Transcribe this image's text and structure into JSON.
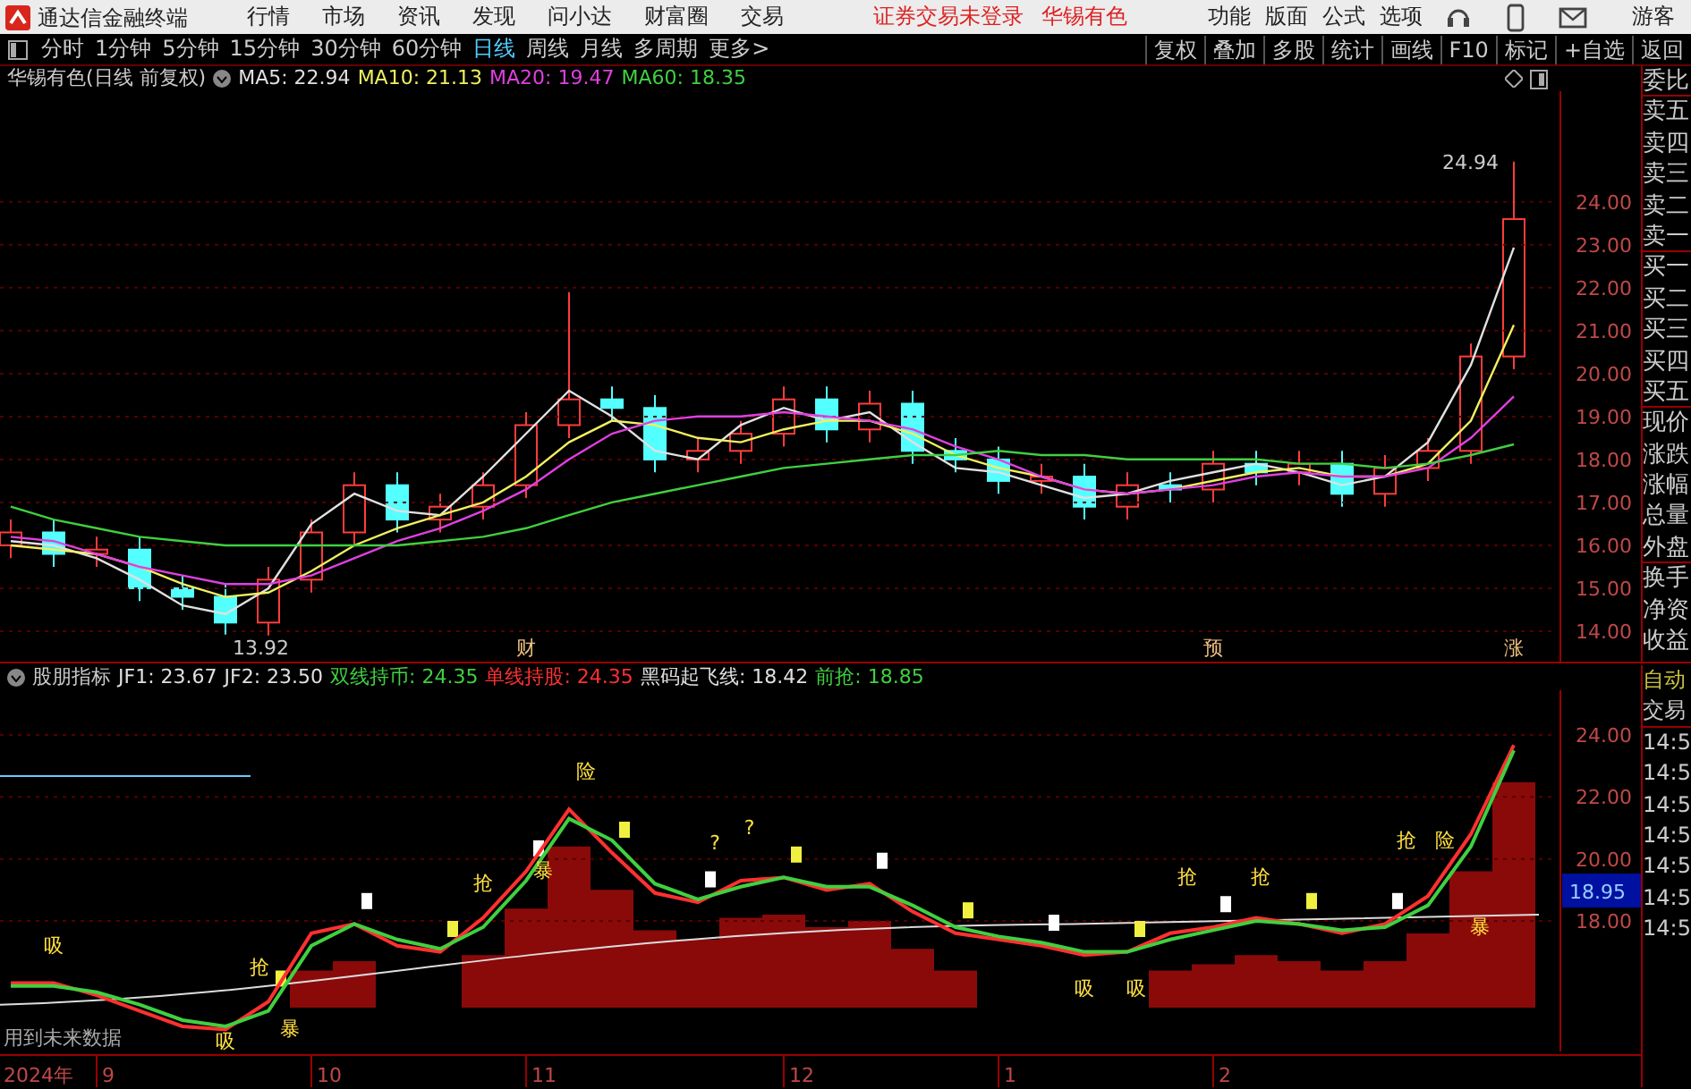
{
  "title_bar": {
    "app_title": "通达信金融终端",
    "menu": [
      "行情",
      "市场",
      "资讯",
      "发现",
      "问小达",
      "财富圈",
      "交易"
    ],
    "notices": [
      "证券交易未登录",
      "华锡有色"
    ],
    "right_menu": [
      "功能",
      "版面",
      "公式",
      "选项"
    ],
    "user": "游客"
  },
  "period_tabs": [
    {
      "label": "分时",
      "selected": false
    },
    {
      "label": "1分钟",
      "selected": false
    },
    {
      "label": "5分钟",
      "selected": false
    },
    {
      "label": "15分钟",
      "selected": false
    },
    {
      "label": "30分钟",
      "selected": false
    },
    {
      "label": "60分钟",
      "selected": false
    },
    {
      "label": "日线",
      "selected": true
    },
    {
      "label": "周线",
      "selected": false
    },
    {
      "label": "月线",
      "selected": false
    },
    {
      "label": "多周期",
      "selected": false
    },
    {
      "label": "更多>",
      "selected": false
    }
  ],
  "tool_buttons": [
    "复权",
    "叠加",
    "多股",
    "统计",
    "画线",
    "F10",
    "标记",
    "+自选",
    "返回"
  ],
  "price_chart": {
    "title": "华锡有色(日线 前复权)",
    "legend": [
      {
        "label": "MA5: 22.94",
        "color": "#e0e0e0"
      },
      {
        "label": "MA10: 21.13",
        "color": "#f0f060"
      },
      {
        "label": "MA20: 19.47",
        "color": "#e040e0"
      },
      {
        "label": "MA60: 18.35",
        "color": "#40d040"
      }
    ],
    "low_label": "13.92",
    "high_label": "24.94",
    "event_flags": [
      "财",
      "预",
      "涨"
    ],
    "candles": {
      "chart_data": {
        "type": "candlestick",
        "grid": true,
        "categories": [
          null,
          null,
          null,
          null,
          null,
          null,
          null,
          null,
          null,
          null,
          null,
          null,
          null,
          null,
          null,
          null,
          null,
          null,
          null,
          null,
          null,
          null,
          null,
          null,
          null,
          null,
          null,
          null,
          null,
          null,
          null,
          null,
          null,
          null,
          null,
          null
        ],
        "ylim": [
          13.29,
          26.58
        ],
        "yticks": [
          {
            "value": 14,
            "label": "14.00"
          },
          {
            "value": 16,
            "label": "16.00"
          },
          {
            "value": 18,
            "label": "18.00"
          },
          {
            "value": 20,
            "label": "20.00"
          },
          {
            "value": 22,
            "label": "22.00"
          },
          {
            "value": 24,
            "label": "24.00"
          }
        ],
        "ohlc": [
          [
            16.0,
            16.6,
            15.7,
            16.3
          ],
          [
            16.3,
            16.6,
            15.5,
            15.8
          ],
          [
            15.8,
            16.2,
            15.5,
            15.9
          ],
          [
            15.9,
            16.2,
            14.7,
            15.0
          ],
          [
            15.0,
            15.3,
            14.5,
            14.8
          ],
          [
            14.8,
            15.1,
            13.92,
            14.2
          ],
          [
            14.2,
            15.5,
            13.9,
            15.2
          ],
          [
            15.2,
            16.6,
            14.9,
            16.3
          ],
          [
            16.3,
            17.7,
            16.0,
            17.4
          ],
          [
            17.4,
            17.7,
            16.3,
            16.6
          ],
          [
            16.6,
            17.2,
            16.3,
            16.9
          ],
          [
            16.9,
            17.7,
            16.6,
            17.4
          ],
          [
            17.4,
            19.1,
            17.1,
            18.8
          ],
          [
            18.8,
            21.9,
            18.5,
            19.4
          ],
          [
            19.4,
            19.7,
            18.9,
            19.2
          ],
          [
            19.2,
            19.5,
            17.7,
            18.0
          ],
          [
            18.0,
            18.5,
            17.7,
            18.2
          ],
          [
            18.2,
            18.9,
            17.9,
            18.6
          ],
          [
            18.6,
            19.7,
            18.3,
            19.4
          ],
          [
            19.4,
            19.7,
            18.4,
            18.7
          ],
          [
            18.7,
            19.6,
            18.4,
            19.3
          ],
          [
            19.3,
            19.6,
            17.9,
            18.2
          ],
          [
            18.2,
            18.5,
            17.7,
            18.0
          ],
          [
            18.0,
            18.3,
            17.2,
            17.5
          ],
          [
            17.5,
            17.9,
            17.2,
            17.6
          ],
          [
            17.6,
            17.9,
            16.6,
            16.9
          ],
          [
            16.9,
            17.7,
            16.6,
            17.4
          ],
          [
            17.4,
            17.7,
            17.0,
            17.3
          ],
          [
            17.3,
            18.2,
            17.0,
            17.9
          ],
          [
            17.9,
            18.2,
            17.4,
            17.7
          ],
          [
            17.7,
            18.2,
            17.4,
            17.9
          ],
          [
            17.9,
            18.2,
            16.9,
            17.2
          ],
          [
            17.2,
            18.1,
            16.9,
            17.8
          ],
          [
            17.8,
            18.5,
            17.5,
            18.2
          ],
          [
            18.2,
            20.7,
            17.9,
            20.4
          ],
          [
            20.4,
            24.94,
            20.1,
            23.6
          ]
        ]
      }
    },
    "moving_averages": {
      "chart_data": {
        "type": "line",
        "grid": true,
        "categories": [
          null,
          null,
          null,
          null,
          null,
          null,
          null,
          null,
          null,
          null,
          null,
          null,
          null,
          null,
          null,
          null,
          null,
          null,
          null,
          null,
          null,
          null,
          null,
          null,
          null,
          null,
          null,
          null,
          null,
          null,
          null,
          null,
          null,
          null,
          null,
          null
        ],
        "ylim": [
          13.29,
          26.58
        ],
        "yticks": [
          {
            "value": 15,
            "label": "15.00"
          },
          {
            "value": 17,
            "label": "17.00"
          },
          {
            "value": 19,
            "label": "19.00"
          },
          {
            "value": 21,
            "label": "21.00"
          },
          {
            "value": 23,
            "label": "23.00"
          }
        ],
        "series": [
          {
            "color": "#e0e0e0",
            "values": [
              16.1,
              16.0,
              15.7,
              15.2,
              14.6,
              14.4,
              15.0,
              16.5,
              17.2,
              16.8,
              16.7,
              17.6,
              18.6,
              19.6,
              19.0,
              18.2,
              18.0,
              18.8,
              19.2,
              18.9,
              19.1,
              18.4,
              17.8,
              17.7,
              17.4,
              17.1,
              17.2,
              17.5,
              17.7,
              17.9,
              17.7,
              17.4,
              17.6,
              18.4,
              20.2,
              22.94
            ]
          },
          {
            "color": "#f0f060",
            "values": [
              16.0,
              15.9,
              15.8,
              15.5,
              15.1,
              14.8,
              14.9,
              15.4,
              16.0,
              16.4,
              16.7,
              17.0,
              17.6,
              18.4,
              18.9,
              18.8,
              18.5,
              18.4,
              18.7,
              18.9,
              18.9,
              18.6,
              18.1,
              17.8,
              17.6,
              17.3,
              17.2,
              17.3,
              17.5,
              17.7,
              17.8,
              17.6,
              17.6,
              17.9,
              18.9,
              21.13
            ]
          },
          {
            "color": "#e040e0",
            "values": [
              16.2,
              16.1,
              15.8,
              15.5,
              15.3,
              15.1,
              15.1,
              15.3,
              15.7,
              16.1,
              16.4,
              16.8,
              17.3,
              18.0,
              18.6,
              18.9,
              19.0,
              19.0,
              19.1,
              19.0,
              18.9,
              18.7,
              18.3,
              18.0,
              17.6,
              17.3,
              17.2,
              17.3,
              17.4,
              17.6,
              17.7,
              17.6,
              17.6,
              17.8,
              18.5,
              19.47
            ]
          },
          {
            "color": "#40d040",
            "values": [
              16.9,
              16.6,
              16.4,
              16.2,
              16.1,
              16.0,
              16.0,
              16.0,
              16.0,
              16.0,
              16.1,
              16.2,
              16.4,
              16.7,
              17.0,
              17.2,
              17.4,
              17.6,
              17.8,
              17.9,
              18.0,
              18.1,
              18.1,
              18.2,
              18.1,
              18.1,
              18.0,
              18.0,
              18.0,
              18.0,
              17.9,
              17.9,
              17.8,
              17.9,
              18.1,
              18.35
            ]
          }
        ]
      }
    }
  },
  "indicator": {
    "name": "股朋指标",
    "legend": [
      {
        "label": "JF1: 23.67",
        "color": "#e0e0e0"
      },
      {
        "label": "JF2: 23.50",
        "color": "#e0e0e0"
      },
      {
        "label": "双线持币: 24.35",
        "color": "#40d040"
      },
      {
        "label": "单线持股: 24.35",
        "color": "#ff3030"
      },
      {
        "label": "黑码起飞线: 18.42",
        "color": "#e0e0e0"
      },
      {
        "label": "前抢: 18.85",
        "color": "#40d040"
      }
    ],
    "current_value": "18.95",
    "note": "用到未来数据",
    "year_label": "2024年",
    "markers": [
      "吸",
      "吸",
      "抢",
      "暴",
      "抢",
      "暴",
      "险",
      "?",
      "?",
      "吸",
      "吸",
      "抢",
      "抢",
      "抢",
      "险",
      "暴"
    ],
    "chart_data": {
      "type": "line",
      "grid": true,
      "categories": [
        null,
        null,
        "9",
        null,
        null,
        null,
        null,
        "10",
        null,
        null,
        null,
        null,
        "11",
        null,
        null,
        null,
        null,
        null,
        "12",
        null,
        null,
        null,
        null,
        "1",
        null,
        null,
        null,
        null,
        "2",
        null,
        null,
        null,
        null,
        null,
        null,
        null
      ],
      "ylim": [
        13.79,
        25.44
      ],
      "yticks": [
        {
          "value": 18,
          "label": "18.00"
        },
        {
          "value": 20,
          "label": "20.00"
        },
        {
          "value": 22,
          "label": "22.00"
        },
        {
          "value": 24,
          "label": "24.00"
        }
      ],
      "series": [
        {
          "color": "#ff3030",
          "values": [
            16.0,
            16.0,
            15.6,
            15.1,
            14.6,
            14.5,
            15.4,
            17.6,
            17.9,
            17.2,
            17.0,
            18.1,
            19.6,
            21.6,
            20.2,
            18.9,
            18.6,
            19.3,
            19.4,
            19.0,
            19.2,
            18.3,
            17.6,
            17.4,
            17.2,
            16.9,
            17.0,
            17.6,
            17.8,
            18.1,
            17.9,
            17.6,
            17.9,
            18.8,
            20.8,
            23.67
          ]
        },
        {
          "color": "#40d040",
          "values": [
            15.9,
            15.9,
            15.7,
            15.3,
            14.8,
            14.6,
            15.1,
            17.2,
            17.9,
            17.4,
            17.1,
            17.8,
            19.3,
            21.3,
            20.6,
            19.2,
            18.7,
            19.1,
            19.4,
            19.1,
            19.1,
            18.5,
            17.8,
            17.5,
            17.3,
            17.0,
            17.0,
            17.4,
            17.7,
            18.0,
            17.9,
            17.7,
            17.8,
            18.5,
            20.4,
            23.5
          ]
        }
      ]
    }
  },
  "quote_panel": {
    "labels": [
      "委比",
      "卖五",
      "卖四",
      "卖三",
      "卖二",
      "卖一",
      "买一",
      "买二",
      "买三",
      "买四",
      "买五",
      "现价",
      "涨跌",
      "涨幅",
      "总量",
      "外盘",
      "换手",
      "净资",
      "收益"
    ],
    "trade_header": [
      "自动",
      "交易"
    ],
    "times": [
      "14:5",
      "14:5",
      "14:5",
      "14:5",
      "14:5",
      "14:5",
      "14:5"
    ]
  }
}
